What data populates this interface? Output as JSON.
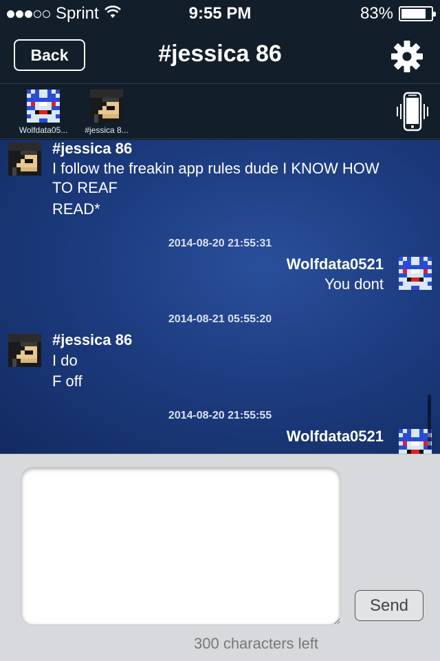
{
  "status_bar": {
    "carrier": "Sprint",
    "signal_bars_filled": 3,
    "signal_bars_total": 5,
    "time": "9:55 PM",
    "battery_text": "83%",
    "battery_level": 0.83
  },
  "nav": {
    "back_label": "Back",
    "title": "#jessica 86",
    "settings_icon": "gear-icon"
  },
  "participants": [
    {
      "name": "Wolfdata05...",
      "avatar": "wolf"
    },
    {
      "name": "#jessica 8...",
      "avatar": "jessica"
    }
  ],
  "messages": [
    {
      "side": "left",
      "sender": "#jessica 86",
      "lines": [
        "I follow the freakin app rules dude I KNOW HOW",
        "TO REAF",
        "READ*"
      ]
    },
    {
      "timestamp": "2014-08-20 21:55:31",
      "side": "right",
      "sender": "Wolfdata0521",
      "lines": [
        "You dont"
      ]
    },
    {
      "timestamp": "2014-08-21 05:55:20",
      "side": "left",
      "sender": "#jessica 86",
      "lines": [
        "I do",
        "F off"
      ]
    },
    {
      "timestamp": "2014-08-20 21:55:55",
      "side": "right",
      "sender": "Wolfdata0521",
      "lines": []
    }
  ],
  "compose": {
    "input_value": "",
    "send_label": "Send",
    "chars_left": "300 characters left"
  },
  "colors": {
    "bar_bg": "#121e2a",
    "chat_bg": "#1d3c80",
    "compose_bg": "#d7d9dc"
  }
}
